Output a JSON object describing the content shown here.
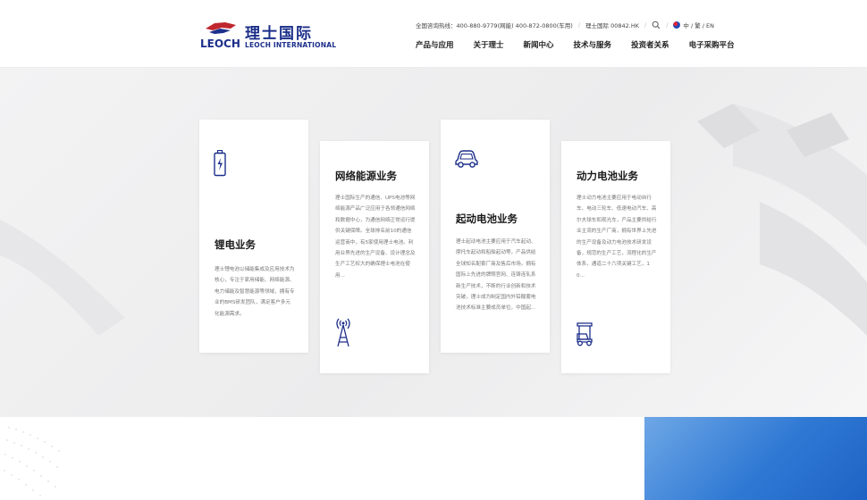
{
  "header": {
    "logo_cn": "理士国际",
    "logo_en": "LEOCH INTERNATIONAL",
    "logo_mark": "LEOCH",
    "hotline": "全国咨询热线：400-880-9779(网能) 400-872-0800(车用)",
    "stock": "理士国际 00842.HK",
    "lang": "中 / 繁 / EN",
    "nav": [
      "产品与应用",
      "关于理士",
      "新闻中心",
      "技术与服务",
      "投资者关系",
      "电子采购平台"
    ]
  },
  "cards": [
    {
      "title": "锂电业务",
      "icon": "battery-icon",
      "desc": "理士锂电池以储能集成及应用技术为核心，专注于家用储能、网络能源、电力储能及智慧能源等领域，拥有专业的BMS研发团队，满足客户多元化能源需求。"
    },
    {
      "title": "网络能源业务",
      "icon": "signal-tower-icon",
      "desc": "理士国际生产的通信、UPS电池等网络能源产品广泛应用于各领通信网络和数据中心，为通信网络正常运行提供关键保障。全球排名前10的通信运营商中，有5家使用理士电池。利用业界先进的生产设备、设计理念及生产工艺权大的确保理士电池在使用..."
    },
    {
      "title": "起动电池业务",
      "icon": "car-icon",
      "desc": "理士起动电池主要应用于汽车起动、摩托车起动和船舶起动等，产品供给全球知名配套厂商及售后市场。拥有国际上先进的牌照官网、连铸连轧系新生产技术，不断的行业创新和技术突破，理士成为制定国内外铅酸蓄电池技术标准主要成员单位，中国起..."
    },
    {
      "title": "动力电池业务",
      "icon": "golf-cart-icon",
      "desc": "理士动力电池主要应用于电动自行车、电动三轮车、低速电动汽车、高尔夫球车和观光车，产品主要供给行业主流的生产厂商，拥有世界上先进的生产设备及动力电池技术研发设备，规范的生产工艺，流程化的生产体系，通道二十六项关键工艺，10..."
    }
  ],
  "colors": {
    "brand": "#1c2f8a",
    "accent_blue": "#2f79d4"
  }
}
